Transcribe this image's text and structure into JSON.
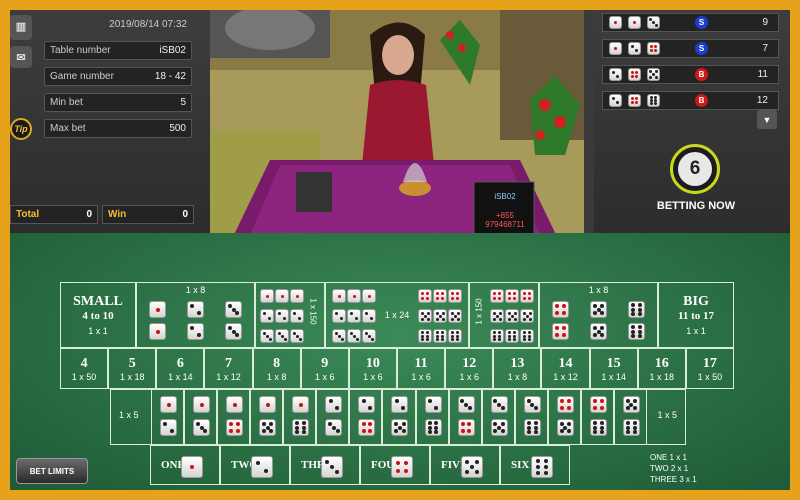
{
  "left_panel": {
    "datetime": "2019/08/14   07:32",
    "rows": [
      {
        "label": "Table number",
        "value": "iSB02"
      },
      {
        "label": "Game number",
        "value": "18 - 42"
      },
      {
        "label": "Min bet",
        "value": "5"
      },
      {
        "label": "Max bet",
        "value": "500"
      }
    ],
    "total_label": "Total",
    "total_value": "0",
    "win_label": "Win",
    "win_value": "0",
    "tip_label": "Tip"
  },
  "video": {
    "screen_line1": "iSB02",
    "screen_line2": "+855 979468711"
  },
  "history": [
    {
      "dice": [
        1,
        1,
        3
      ],
      "result": "S",
      "total": "9",
      "color": "#1a3fd0"
    },
    {
      "dice": [
        1,
        2,
        4
      ],
      "result": "S",
      "total": "7",
      "color": "#1a3fd0"
    },
    {
      "dice": [
        2,
        4,
        5
      ],
      "result": "B",
      "total": "11",
      "color": "#d01818"
    },
    {
      "dice": [
        2,
        4,
        6
      ],
      "result": "B",
      "total": "12",
      "color": "#d01818"
    }
  ],
  "timer": {
    "value": "6",
    "label": "BETTING NOW"
  },
  "board": {
    "small": {
      "title": "SMALL",
      "range": "4 to 10",
      "odds": "1 x 1"
    },
    "big": {
      "title": "BIG",
      "range": "11 to 17",
      "odds": "1 x 1"
    },
    "doubles_odds": "1 x 8",
    "triples_odds": "1 x 24",
    "triples_side_odds": "1 x 150",
    "totals": [
      {
        "num": "4",
        "odds": "1 x 50"
      },
      {
        "num": "5",
        "odds": "1 x 18"
      },
      {
        "num": "6",
        "odds": "1 x 14"
      },
      {
        "num": "7",
        "odds": "1 x 12"
      },
      {
        "num": "8",
        "odds": "1 x 8"
      },
      {
        "num": "9",
        "odds": "1 x 6"
      },
      {
        "num": "10",
        "odds": "1 x 6"
      },
      {
        "num": "11",
        "odds": "1 x 6"
      },
      {
        "num": "12",
        "odds": "1 x 6"
      },
      {
        "num": "13",
        "odds": "1 x 8"
      },
      {
        "num": "14",
        "odds": "1 x 12"
      },
      {
        "num": "15",
        "odds": "1 x 14"
      },
      {
        "num": "16",
        "odds": "1 x 18"
      },
      {
        "num": "17",
        "odds": "1 x 50"
      }
    ],
    "combo_odds": "1 x 5",
    "combos": [
      [
        1,
        2
      ],
      [
        1,
        3
      ],
      [
        1,
        4
      ],
      [
        1,
        5
      ],
      [
        1,
        6
      ],
      [
        2,
        3
      ],
      [
        2,
        4
      ],
      [
        2,
        5
      ],
      [
        2,
        6
      ],
      [
        3,
        4
      ],
      [
        3,
        5
      ],
      [
        3,
        6
      ],
      [
        4,
        5
      ],
      [
        4,
        6
      ],
      [
        5,
        6
      ]
    ],
    "singles": [
      {
        "label": "ONE",
        "face": 1
      },
      {
        "label": "TWO",
        "face": 2
      },
      {
        "label": "THREE",
        "face": 3
      },
      {
        "label": "FOUR",
        "face": 4
      },
      {
        "label": "FIVE",
        "face": 5
      },
      {
        "label": "SIX",
        "face": 6
      }
    ],
    "single_odds": [
      "ONE 1 x 1",
      "TWO 2 x 1",
      "THREE 3 x 1"
    ],
    "bet_limits": "BET LIMITS"
  }
}
